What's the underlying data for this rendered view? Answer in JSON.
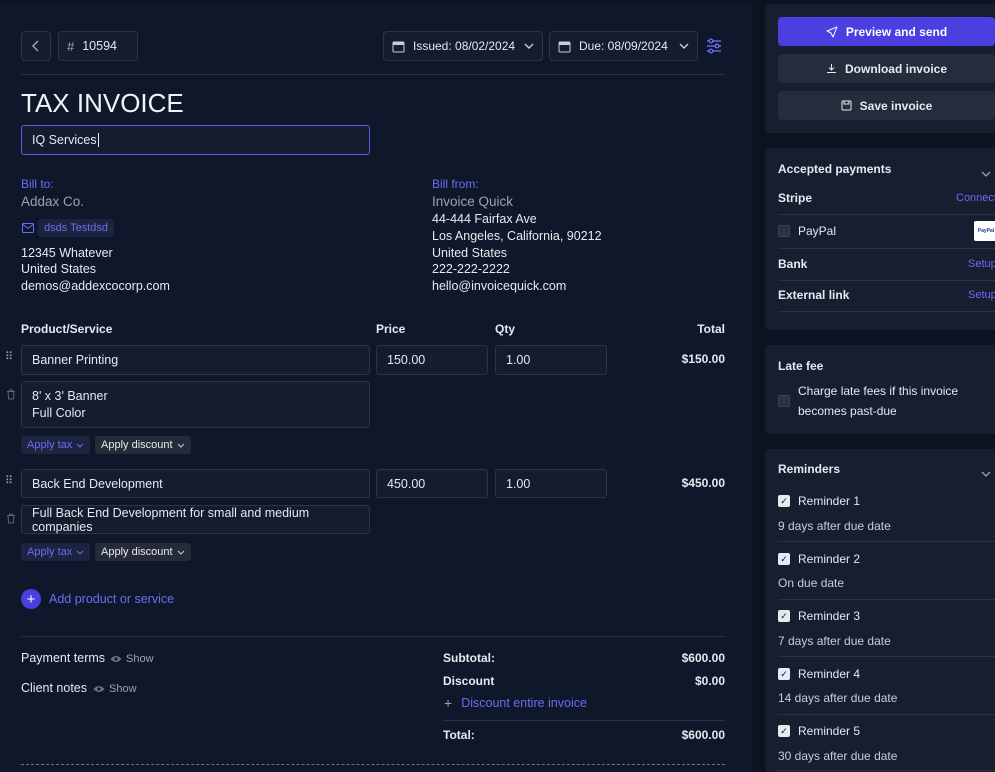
{
  "header": {
    "invoice_number_prefix": "#",
    "invoice_number": "10594",
    "issued": "Issued: 08/02/2024",
    "due": "Due: 08/09/2024"
  },
  "doc": {
    "title": "TAX INVOICE",
    "company_name_value": "IQ Services"
  },
  "bill_to": {
    "label": "Bill to:",
    "name": "Addax Co.",
    "contact_chip": "dsds Testdsd",
    "address1": "12345 Whatever",
    "country": "United States",
    "email": "demos@addexcocorp.com"
  },
  "bill_from": {
    "label": "Bill from:",
    "name": "Invoice Quick",
    "address1": "44-444 Fairfax Ave",
    "address2": "Los Angeles, California, 90212",
    "country": "United States",
    "phone": "222-222-2222",
    "email": "hello@invoicequick.com"
  },
  "table": {
    "col_product": "Product/Service",
    "col_price": "Price",
    "col_qty": "Qty",
    "col_total": "Total",
    "items": [
      {
        "name": "Banner Printing",
        "price": "150.00",
        "qty": "1.00",
        "total": "$150.00",
        "desc_line1": "8' x 3' Banner",
        "desc_line2": "Full Color",
        "apply_tax": "Apply tax",
        "apply_discount": "Apply discount"
      },
      {
        "name": "Back End Development",
        "price": "450.00",
        "qty": "1.00",
        "total": "$450.00",
        "desc_line1": "Full Back End Development for small and medium companies",
        "apply_tax": "Apply tax",
        "apply_discount": "Apply discount"
      }
    ],
    "add_item": "Add product or service"
  },
  "footer": {
    "payment_terms": "Payment terms",
    "client_notes": "Client notes",
    "show": "Show",
    "subtotal_label": "Subtotal:",
    "subtotal_value": "$600.00",
    "discount_label": "Discount",
    "discount_value": "$0.00",
    "discount_link": "Discount entire invoice",
    "total_label": "Total:",
    "total_value": "$600.00"
  },
  "sidebar": {
    "preview_send": "Preview and send",
    "download": "Download invoice",
    "save": "Save invoice",
    "payments": {
      "title": "Accepted payments",
      "stripe": "Stripe",
      "stripe_action": "Connect",
      "paypal": "PayPal",
      "paypal_logo": "PayPal",
      "bank": "Bank",
      "bank_action": "Setup",
      "external": "External link",
      "external_action": "Setup"
    },
    "late_fee": {
      "title": "Late fee",
      "text_line1": "Charge late fees if this invoice",
      "text_line2": "becomes past-due"
    },
    "reminders": {
      "title": "Reminders",
      "items": [
        {
          "name": "Reminder 1",
          "when": "9 days after due date"
        },
        {
          "name": "Reminder 2",
          "when": "On due date"
        },
        {
          "name": "Reminder 3",
          "when": "7 days after due date"
        },
        {
          "name": "Reminder 4",
          "when": "14 days after due date"
        },
        {
          "name": "Reminder 5",
          "when": "30 days after due date"
        }
      ]
    }
  },
  "colors": {
    "accent": "#6d6cf2",
    "primary_button": "#4b3fe0"
  }
}
